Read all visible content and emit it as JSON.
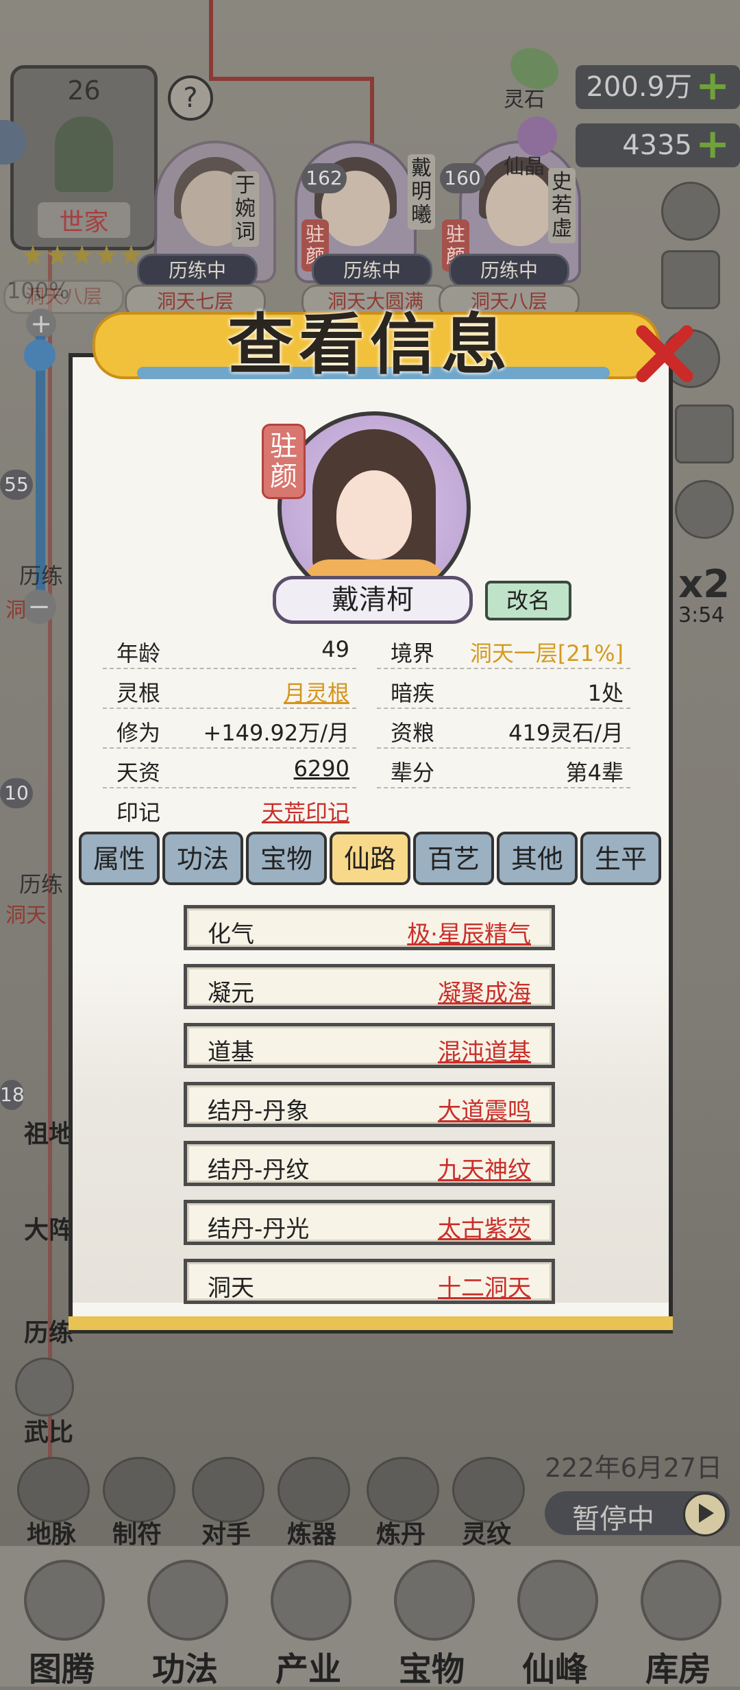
{
  "background": {
    "family_level": "26",
    "family_label": "世家",
    "family_progress": "100%",
    "family_realm": "洞天八层",
    "question_icon": "?",
    "resources": [
      {
        "label": "灵石",
        "value": "200.9万"
      },
      {
        "label": "仙晶",
        "value": "4335"
      }
    ],
    "members": [
      {
        "name": "于婉词",
        "status": "历练中",
        "realm": "洞天七层"
      },
      {
        "level": "162",
        "name": "戴明曦",
        "seal": "驻颜",
        "status": "历练中",
        "realm": "洞天大圆满"
      },
      {
        "level": "160",
        "name": "史若虚",
        "seal": "驻颜",
        "status": "历练中",
        "realm": "洞天八层"
      }
    ],
    "left_levels": [
      "55",
      "10",
      "18"
    ],
    "left_labels": [
      "历练",
      "洞",
      "历练",
      "洞天",
      "祖地",
      "大阵",
      "历练",
      "武比"
    ],
    "speed": "x2",
    "timer": "3:54",
    "date": "222年6月27日",
    "pause_label": "暂停中",
    "small_items": [
      "地脉",
      "制符",
      "对手",
      "炼器",
      "炼丹",
      "灵纹"
    ],
    "bottom_nav": [
      "图腾",
      "功法",
      "产业",
      "宝物",
      "仙峰",
      "库房"
    ]
  },
  "modal": {
    "title": "查看信息",
    "seal": "驻颜",
    "name": "戴清柯",
    "rename_label": "改名",
    "info": [
      {
        "k": "年龄",
        "v": "49"
      },
      {
        "k": "境界",
        "v": "洞天一层[21%]"
      },
      {
        "k": "灵根",
        "v": "月灵根"
      },
      {
        "k": "暗疾",
        "v": "1处"
      },
      {
        "k": "修为",
        "v": "+149.92万/月"
      },
      {
        "k": "资粮",
        "v": "419灵石/月"
      },
      {
        "k": "天资",
        "v": "6290"
      },
      {
        "k": "辈分",
        "v": "第4辈"
      },
      {
        "k": "印记",
        "v": "天荒印记"
      }
    ],
    "tabs": [
      "属性",
      "功法",
      "宝物",
      "仙路",
      "百艺",
      "其他",
      "生平"
    ],
    "active_tab": "仙路",
    "path": [
      {
        "k": "化气",
        "v": "极·星辰精气"
      },
      {
        "k": "凝元",
        "v": "凝聚成海"
      },
      {
        "k": "道基",
        "v": "混沌道基"
      },
      {
        "k": "结丹-丹象",
        "v": "大道震鸣"
      },
      {
        "k": "结丹-丹纹",
        "v": "九天神纹"
      },
      {
        "k": "结丹-丹光",
        "v": "太古紫荧"
      },
      {
        "k": "洞天",
        "v": "十二洞天"
      }
    ]
  }
}
